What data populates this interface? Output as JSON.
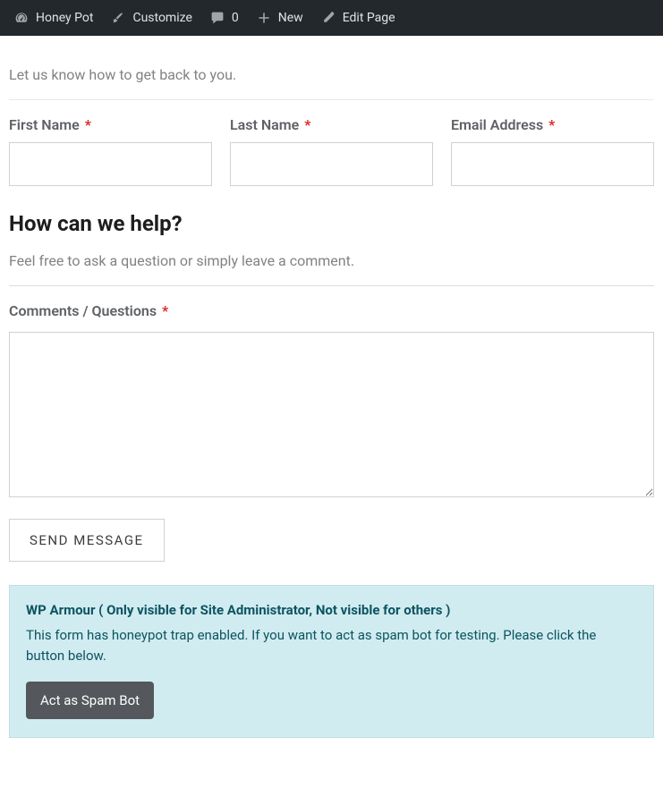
{
  "adminbar": {
    "site_name": "Honey Pot",
    "customize": "Customize",
    "comments_count": "0",
    "new_label": "New",
    "edit_label": "Edit Page"
  },
  "form": {
    "contact_lead": "Let us know how to get back to you.",
    "first_name_label": "First Name",
    "last_name_label": "Last Name",
    "email_label": "Email Address",
    "help_heading": "How can we help?",
    "help_lead": "Feel free to ask a question or simply leave a comment.",
    "comments_label": "Comments / Questions",
    "submit_label": "SEND MESSAGE",
    "required_mark": "*"
  },
  "notice": {
    "title": "WP Armour ( Only visible for Site Administrator, Not visible for others )",
    "body": "This form has honeypot trap enabled. If you want to act as spam bot for testing. Please click the button below.",
    "spam_button_label": "Act as Spam Bot"
  }
}
